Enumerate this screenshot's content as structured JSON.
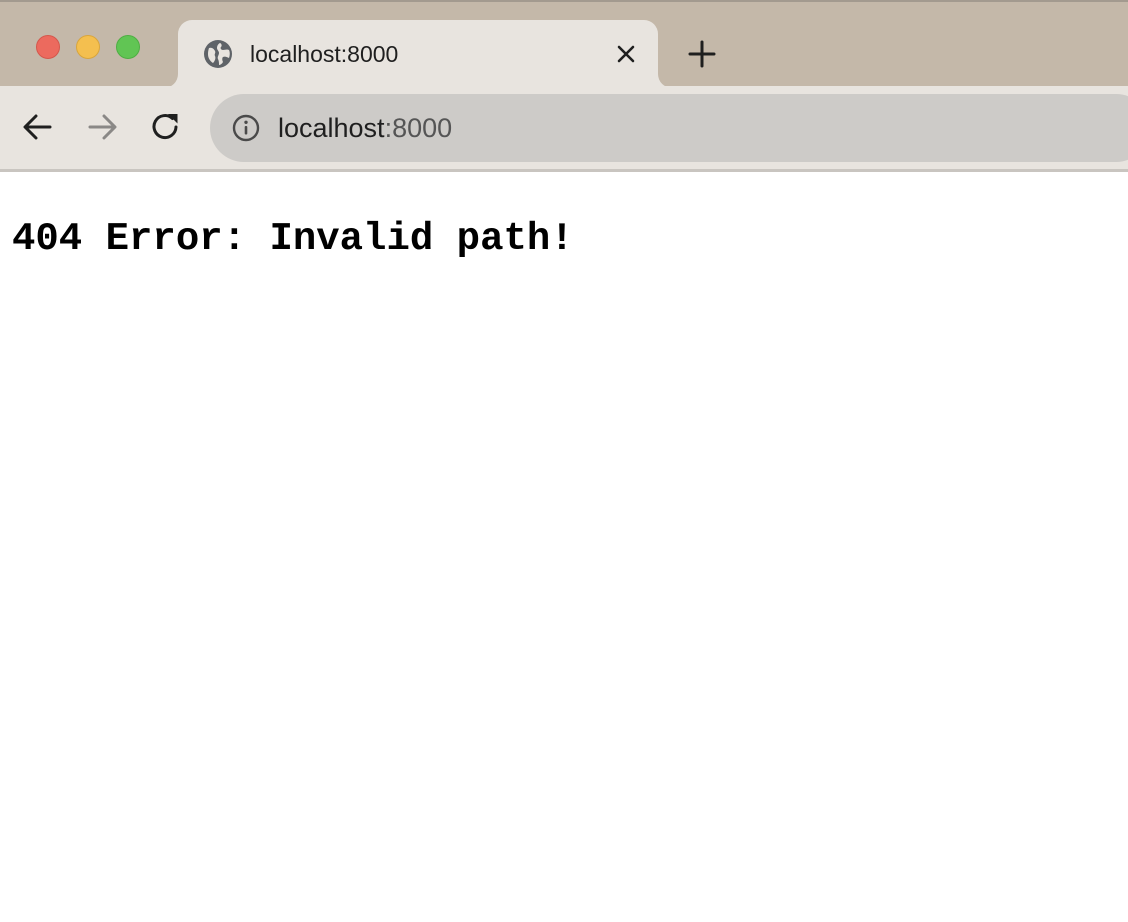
{
  "window": {
    "controls": [
      "close",
      "minimize",
      "zoom"
    ]
  },
  "tab": {
    "title": "localhost:8000",
    "favicon": "globe-icon",
    "close_icon": "close-icon"
  },
  "tabstrip": {
    "new_tab_icon": "plus-icon"
  },
  "toolbar": {
    "back_icon": "arrow-left-icon",
    "forward_icon": "arrow-right-icon",
    "reload_icon": "reload-icon"
  },
  "omnibox": {
    "info_icon": "info-icon",
    "host": "localhost",
    "port": ":8000"
  },
  "page": {
    "text": "404 Error: Invalid path!"
  },
  "colors": {
    "tabstrip_bg": "#c4b8a9",
    "tab_bg": "#e8e4df",
    "omnibox_bg": "#cdcbc8",
    "close_red": "#ec6a5e",
    "minimize_yellow": "#f4bf4f",
    "zoom_green": "#61c554"
  }
}
